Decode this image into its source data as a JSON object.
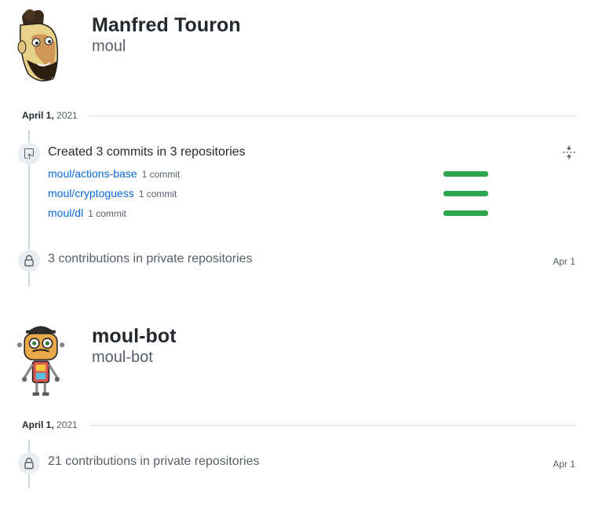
{
  "profiles": [
    {
      "name": "Manfred Touron",
      "login": "moul",
      "date_prefix": "April 1,",
      "date_year": "2021",
      "commits_title": "Created 3 commits in 3 repositories",
      "repos": [
        {
          "name": "moul/actions-base",
          "count": "1 commit",
          "share": 1.0
        },
        {
          "name": "moul/cryptoguess",
          "count": "1 commit",
          "share": 1.0
        },
        {
          "name": "moul/dl",
          "count": "1 commit",
          "share": 1.0
        }
      ],
      "private_text": "3 contributions in private repositories",
      "private_date": "Apr 1"
    },
    {
      "name": "moul-bot",
      "login": "moul-bot",
      "date_prefix": "April 1,",
      "date_year": "2021",
      "private_text": "21 contributions in private repositories",
      "private_date": "Apr 1"
    }
  ],
  "icons": {
    "commits": "repo-push-icon",
    "private": "lock-icon",
    "fold": "fold-icon"
  },
  "colors": {
    "link": "#0969da",
    "bar": "#2da44e",
    "muted": "#57606a"
  }
}
